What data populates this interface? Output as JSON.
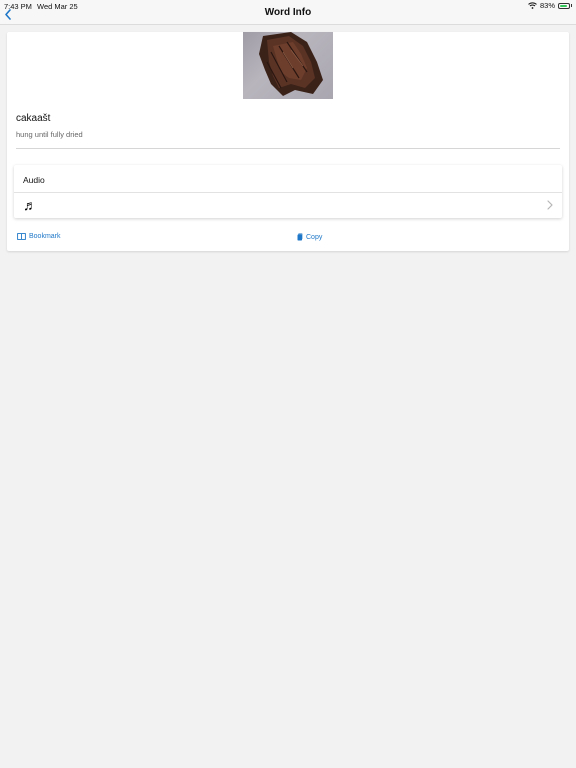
{
  "status_bar": {
    "time": "7:43 PM",
    "date": "Wed Mar 25",
    "battery": "83%",
    "battery_level": 0.83
  },
  "nav": {
    "title": "Word Info",
    "back_icon": "chevron-left-icon"
  },
  "word": {
    "title": "cakaašt",
    "definition": "hung until fully dried"
  },
  "audio": {
    "header": "Audio",
    "row_icon": "music-note-icon",
    "row_glyph": "♬"
  },
  "actions": {
    "bookmark_label": "Bookmark",
    "copy_label": "Copy"
  },
  "colors": {
    "accent": "#1e77c8",
    "background": "#f2f2f2",
    "card": "#ffffff",
    "battery": "#34c759"
  }
}
